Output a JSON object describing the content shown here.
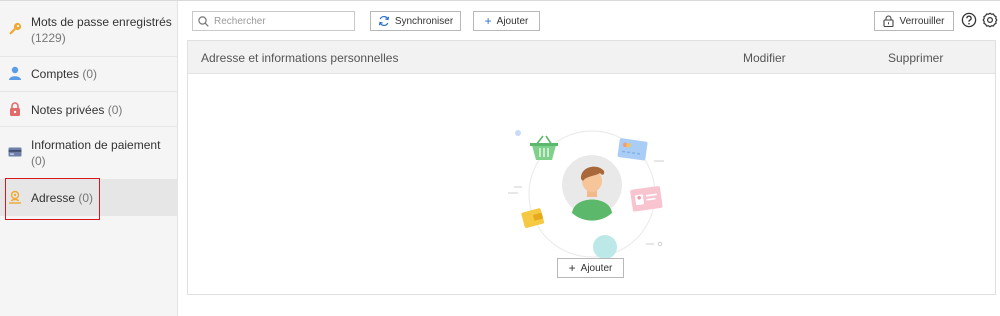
{
  "sidebar": {
    "items": [
      {
        "label": "Mots de passe enregistrés",
        "count": "(1229)",
        "icon": "key-icon"
      },
      {
        "label": "Comptes",
        "count": "(0)",
        "icon": "person-icon"
      },
      {
        "label": "Notes privées",
        "count": "(0)",
        "icon": "lock-note-icon"
      },
      {
        "label": "Information de paiement",
        "count": "(0)",
        "icon": "card-icon"
      },
      {
        "label": "Adresse",
        "count": "(0)",
        "icon": "address-icon",
        "selected": true
      }
    ]
  },
  "toolbar": {
    "search_placeholder": "Rechercher",
    "sync_label": "Synchroniser",
    "add_label": "Ajouter",
    "lock_label": "Verrouiller"
  },
  "table": {
    "columns": [
      "Adresse et informations personnelles",
      "Modifier",
      "Supprimer"
    ]
  },
  "empty_state": {
    "add_label": "Ajouter"
  },
  "colors": {
    "accent_blue": "#2b6fd1",
    "highlight_red": "#d9161c",
    "sidebar_bg": "#f5f5f5"
  }
}
